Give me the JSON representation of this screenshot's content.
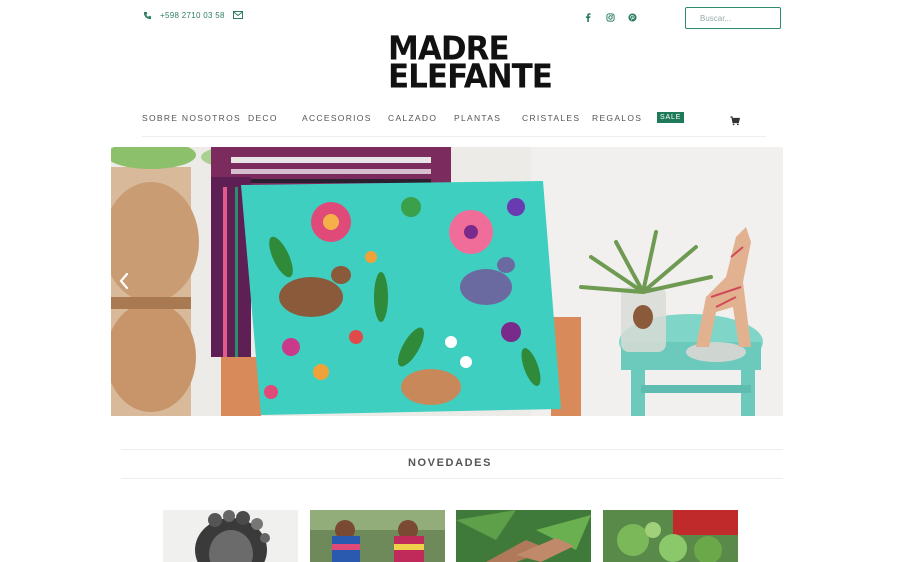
{
  "topbar": {
    "phone": "+598 2710 03 58",
    "phone_icon": "phone-icon",
    "mail_icon": "mail-icon",
    "social": [
      "facebook-icon",
      "instagram-icon",
      "pinterest-icon"
    ],
    "search_placeholder": "Buscar..."
  },
  "brand": {
    "logo_line1": "MADRE",
    "logo_line2": "ELEFANTE"
  },
  "nav": {
    "items": [
      {
        "label": "SOBRE NOSOTROS"
      },
      {
        "label": "DECO"
      },
      {
        "label": "ACCESORIOS"
      },
      {
        "label": "CALZADO"
      },
      {
        "label": "PLANTAS"
      },
      {
        "label": "CRISTALES"
      },
      {
        "label": "REGALOS"
      }
    ],
    "sale_label": "SALE",
    "cart_icon": "cart-icon"
  },
  "hero": {
    "prev_icon": "chevron-left-icon"
  },
  "section": {
    "title": "NOVEDADES"
  },
  "colors": {
    "accent": "#2e8b6f",
    "sale_bg": "#1f7a5a",
    "turquoise": "#3fcfc0"
  }
}
